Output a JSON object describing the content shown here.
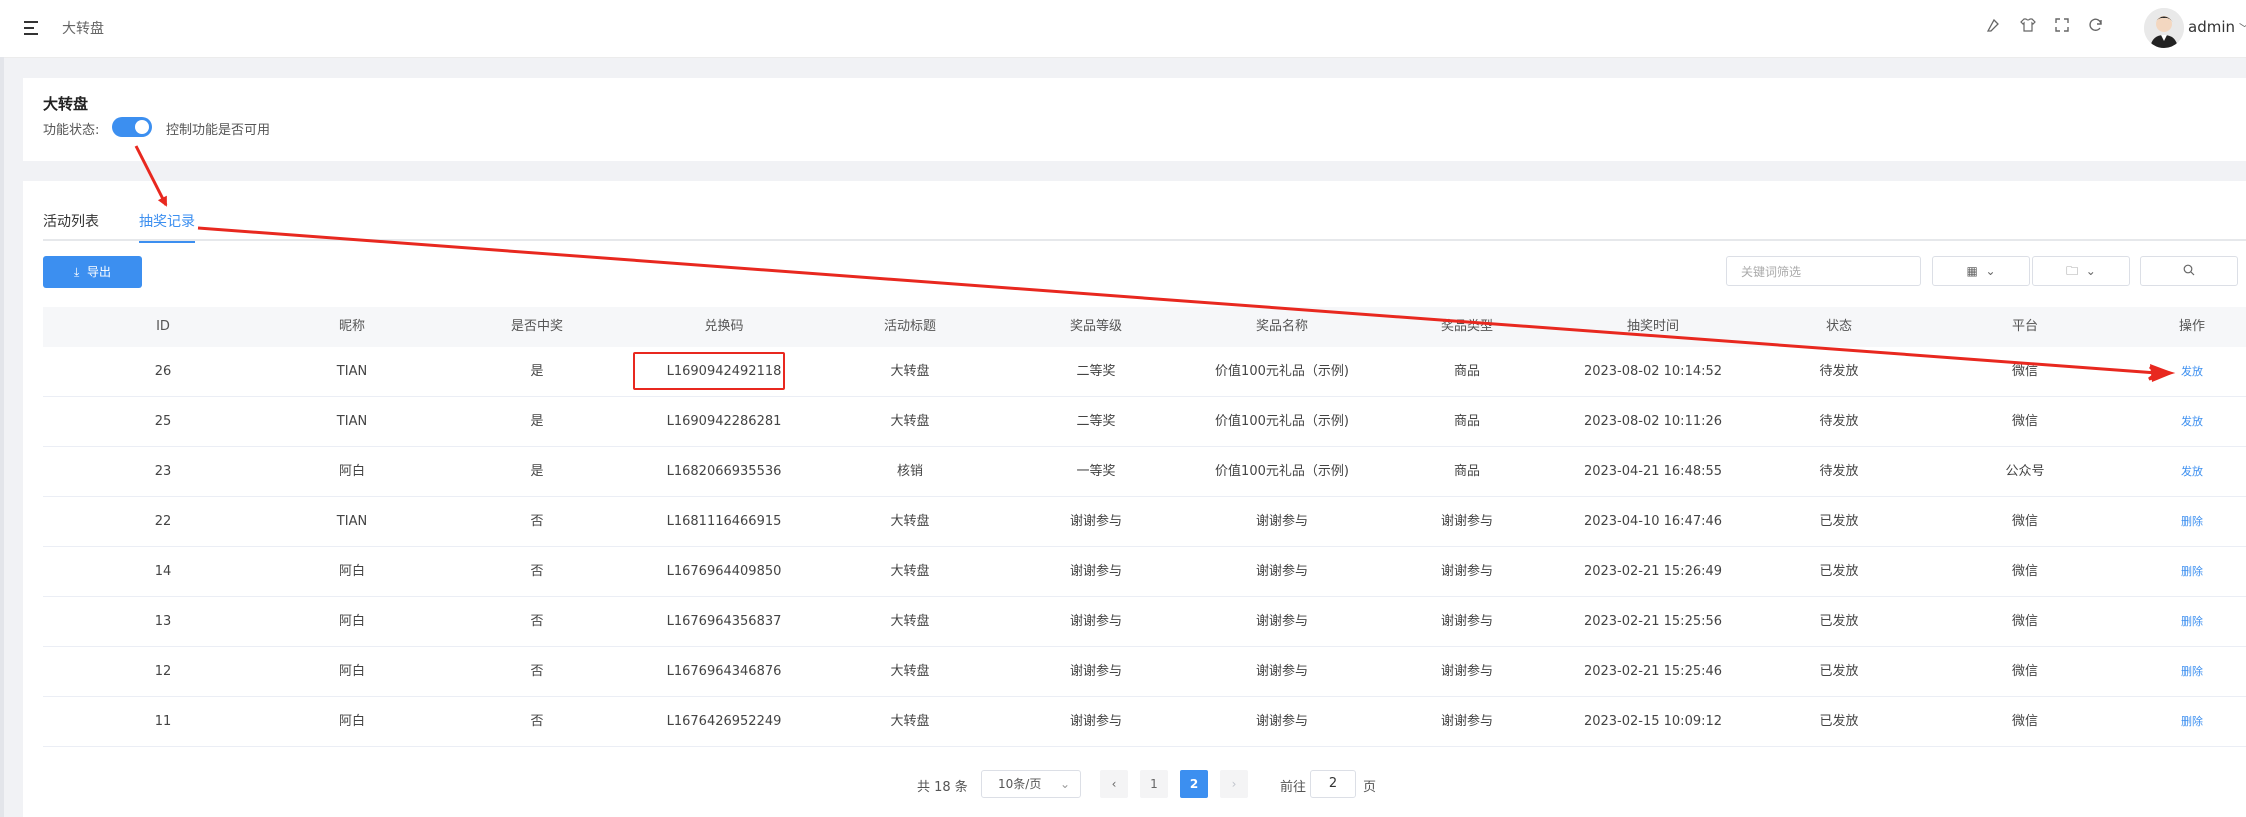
{
  "topbar": {
    "breadcrumb": "大转盘",
    "icons": [
      "menu-icon",
      "brush-icon",
      "shirt-icon",
      "fullscreen-icon",
      "refresh-icon"
    ],
    "username": "admin"
  },
  "feature_card": {
    "title": "大转盘",
    "status_label": "功能状态:",
    "switch_on": true,
    "hint": "控制功能是否可用"
  },
  "tabs": [
    "活动列表",
    "抽奖记录"
  ],
  "toolbar": {
    "export_label": "导出",
    "search_placeholder": "关键词筛选"
  },
  "table": {
    "headers": [
      "ID",
      "昵称",
      "是否中奖",
      "兑换码",
      "活动标题",
      "奖品等级",
      "奖品名称",
      "奖品类型",
      "抽奖时间",
      "状态",
      "平台",
      "操作"
    ],
    "rows": [
      [
        "26",
        "TIAN",
        "是",
        "L1690942492118",
        "大转盘",
        "二等奖",
        "价值100元礼品（示例)",
        "商品",
        "2023-08-02 10:14:52",
        "待发放",
        "微信",
        "发放"
      ],
      [
        "25",
        "TIAN",
        "是",
        "L1690942286281",
        "大转盘",
        "二等奖",
        "价值100元礼品（示例)",
        "商品",
        "2023-08-02 10:11:26",
        "待发放",
        "微信",
        "发放"
      ],
      [
        "23",
        "阿白",
        "是",
        "L1682066935536",
        "核销",
        "一等奖",
        "价值100元礼品（示例)",
        "商品",
        "2023-04-21 16:48:55",
        "待发放",
        "公众号",
        "发放"
      ],
      [
        "22",
        "TIAN",
        "否",
        "L1681116466915",
        "大转盘",
        "谢谢参与",
        "谢谢参与",
        "谢谢参与",
        "2023-04-10 16:47:46",
        "已发放",
        "微信",
        "删除"
      ],
      [
        "14",
        "阿白",
        "否",
        "L1676964409850",
        "大转盘",
        "谢谢参与",
        "谢谢参与",
        "谢谢参与",
        "2023-02-21 15:26:49",
        "已发放",
        "微信",
        "删除"
      ],
      [
        "13",
        "阿白",
        "否",
        "L1676964356837",
        "大转盘",
        "谢谢参与",
        "谢谢参与",
        "谢谢参与",
        "2023-02-21 15:25:56",
        "已发放",
        "微信",
        "删除"
      ],
      [
        "12",
        "阿白",
        "否",
        "L1676964346876",
        "大转盘",
        "谢谢参与",
        "谢谢参与",
        "谢谢参与",
        "2023-02-21 15:25:46",
        "已发放",
        "微信",
        "删除"
      ],
      [
        "11",
        "阿白",
        "否",
        "L1676426952249",
        "大转盘",
        "谢谢参与",
        "谢谢参与",
        "谢谢参与",
        "2023-02-15 10:09:12",
        "已发放",
        "微信",
        "删除"
      ]
    ]
  },
  "pagination": {
    "total": "共 18 条",
    "page_size": "10条/页",
    "pages": [
      "1",
      "2"
    ],
    "current_page": "2",
    "goto_label": "前往",
    "goto_value": "2",
    "page_suffix": "页"
  },
  "colors": {
    "accent": "#3c8ff0",
    "annotation": "#e8281f"
  }
}
